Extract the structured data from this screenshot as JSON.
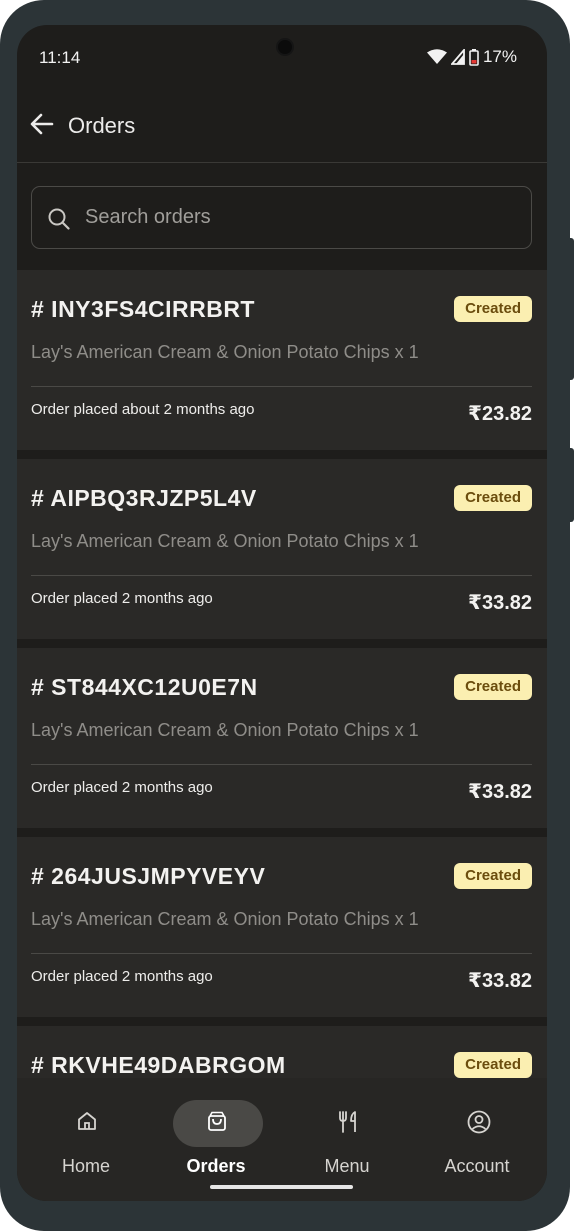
{
  "status_bar": {
    "time": "11:14",
    "battery": "17%"
  },
  "app_bar": {
    "title": "Orders"
  },
  "search": {
    "placeholder": "Search orders"
  },
  "orders": [
    {
      "id": "# INY3FS4CIRRBRT",
      "status": "Created",
      "items": "Lay's American Cream & Onion Potato Chips x 1",
      "placed": "Order placed about 2 months ago",
      "price": "₹23.82"
    },
    {
      "id": "# AIPBQ3RJZP5L4V",
      "status": "Created",
      "items": "Lay's American Cream & Onion Potato Chips x 1",
      "placed": "Order placed 2 months ago",
      "price": "₹33.82"
    },
    {
      "id": "# ST844XC12U0E7N",
      "status": "Created",
      "items": "Lay's American Cream & Onion Potato Chips x 1",
      "placed": "Order placed 2 months ago",
      "price": "₹33.82"
    },
    {
      "id": "# 264JUSJMPYVEYV",
      "status": "Created",
      "items": "Lay's American Cream & Onion Potato Chips x 1",
      "placed": "Order placed 2 months ago",
      "price": "₹33.82"
    },
    {
      "id": "# RKVHE49DABRGOM",
      "status": "Created",
      "items": "",
      "placed": "",
      "price": ""
    }
  ],
  "bottom_nav": {
    "home": "Home",
    "orders": "Orders",
    "menu": "Menu",
    "account": "Account",
    "active": "orders"
  },
  "colors": {
    "badge_bg": "#fbefb1",
    "badge_text": "#6b4d0e",
    "background": "#1e1d1b",
    "card": "#2a2927"
  }
}
